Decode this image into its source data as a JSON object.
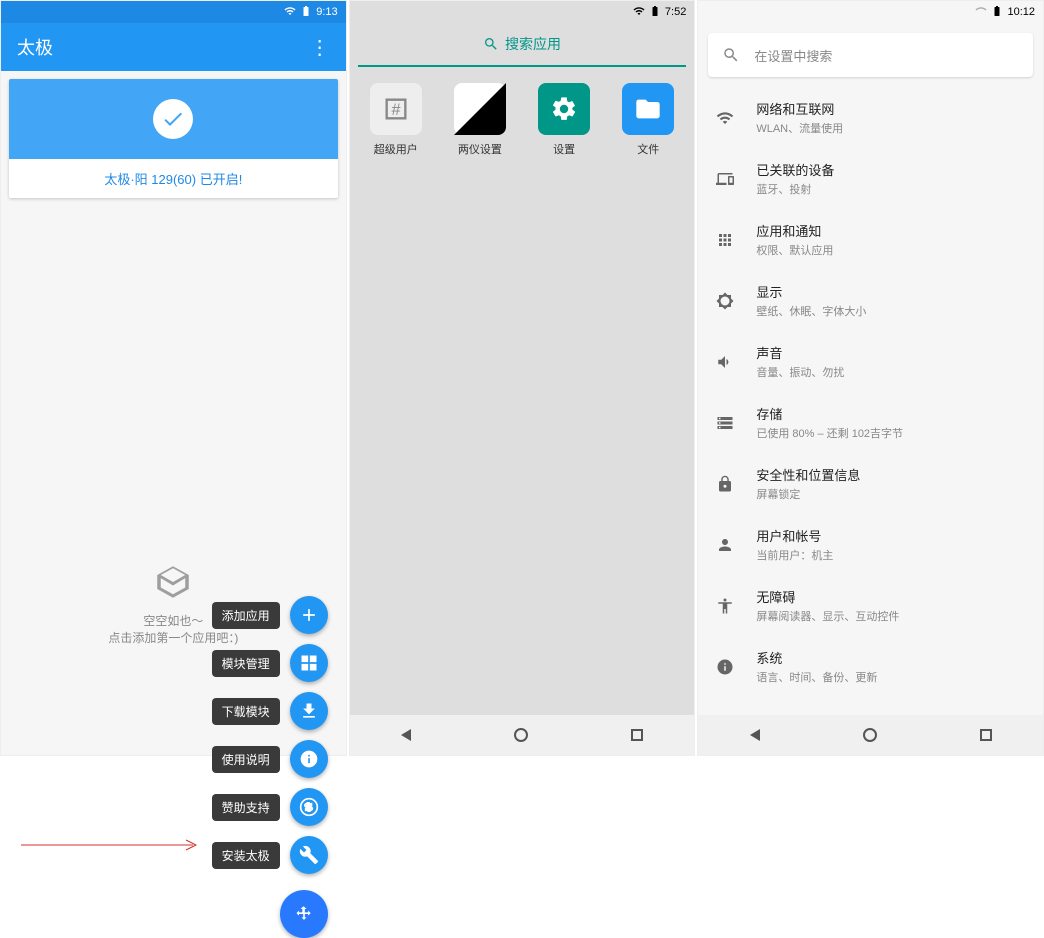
{
  "phone1": {
    "status_time": "9:13",
    "app_title": "太极",
    "card_status": "太极·阳 129(60) 已开启!",
    "empty_line1": "空空如也～",
    "empty_line2": "点击添加第一个应用吧：)",
    "fabs": [
      {
        "label": "添加应用",
        "icon": "plus"
      },
      {
        "label": "模块管理",
        "icon": "grid"
      },
      {
        "label": "下载模块",
        "icon": "download"
      },
      {
        "label": "使用说明",
        "icon": "info"
      },
      {
        "label": "赞助支持",
        "icon": "donate"
      },
      {
        "label": "安装太极",
        "icon": "tools"
      }
    ]
  },
  "phone2": {
    "status_time": "7:52",
    "search_label": "搜索应用",
    "apps": [
      {
        "label": "超级用户"
      },
      {
        "label": "两仪设置"
      },
      {
        "label": "设置"
      },
      {
        "label": "文件"
      }
    ]
  },
  "phone3": {
    "status_time": "10:12",
    "search_placeholder": "在设置中搜索",
    "rows": [
      {
        "title": "网络和互联网",
        "sub": "WLAN、流量使用",
        "icon": "wifi"
      },
      {
        "title": "已关联的设备",
        "sub": "蓝牙、投射",
        "icon": "devices"
      },
      {
        "title": "应用和通知",
        "sub": "权限、默认应用",
        "icon": "apps"
      },
      {
        "title": "显示",
        "sub": "壁纸、休眠、字体大小",
        "icon": "brightness"
      },
      {
        "title": "声音",
        "sub": "音量、振动、勿扰",
        "icon": "volume"
      },
      {
        "title": "存储",
        "sub": "已使用 80% – 还剩 102吉字节",
        "icon": "storage"
      },
      {
        "title": "安全性和位置信息",
        "sub": "屏幕锁定",
        "icon": "lock"
      },
      {
        "title": "用户和帐号",
        "sub": "当前用户：机主",
        "icon": "person"
      },
      {
        "title": "无障碍",
        "sub": "屏幕阅读器、显示、互动控件",
        "icon": "accessibility"
      },
      {
        "title": "系统",
        "sub": "语言、时间、备份、更新",
        "icon": "info"
      }
    ]
  }
}
